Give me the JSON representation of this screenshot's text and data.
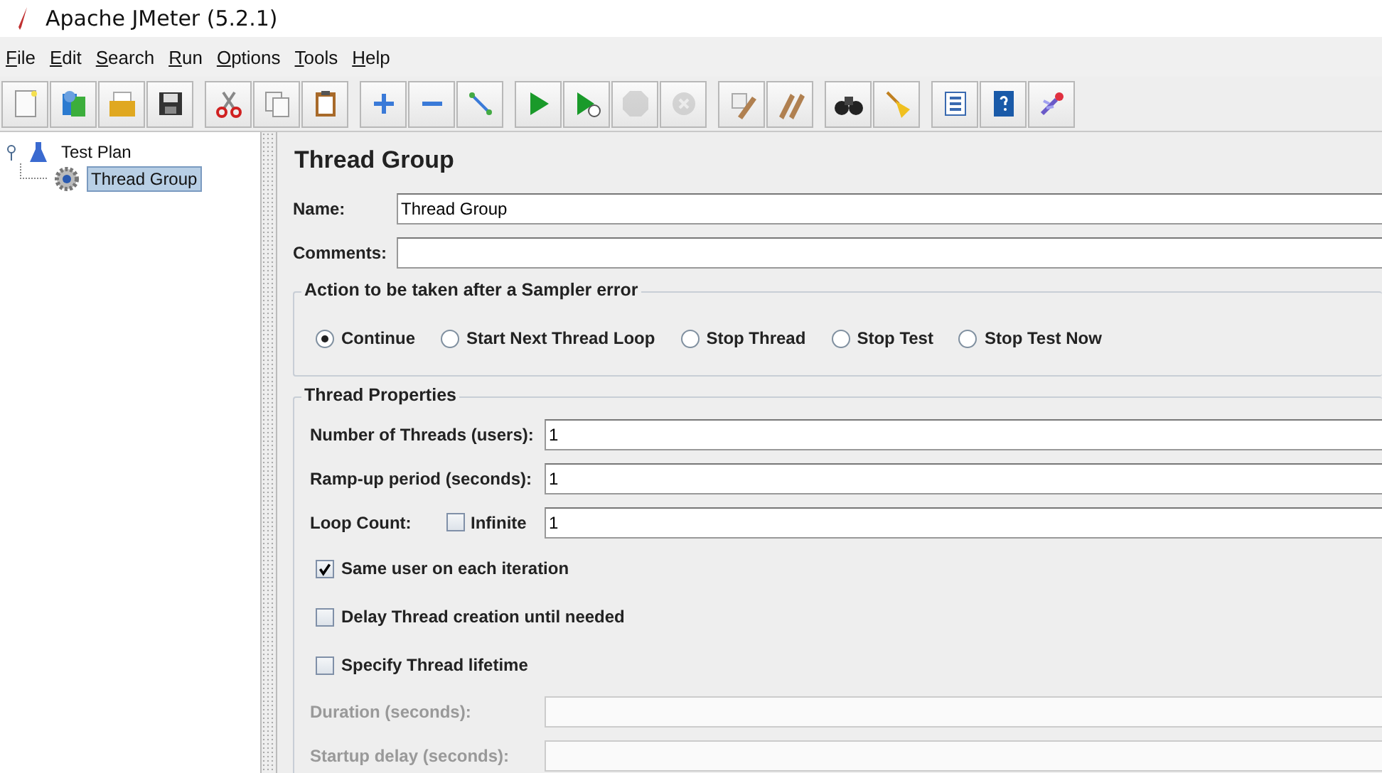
{
  "window": {
    "title": "Apache JMeter (5.2.1)"
  },
  "menu": [
    "File",
    "Edit",
    "Search",
    "Run",
    "Options",
    "Tools",
    "Help"
  ],
  "toolbar": [
    [
      {
        "disabled": false
      },
      {
        "disabled": false
      },
      {
        "disabled": false
      },
      {
        "disabled": false
      }
    ],
    [
      {
        "disabled": false
      },
      {
        "disabled": false
      },
      {
        "disabled": false
      }
    ],
    [
      {
        "disabled": false
      },
      {
        "disabled": false
      },
      {
        "disabled": false
      }
    ],
    [
      {
        "disabled": false
      },
      {
        "disabled": false
      },
      {
        "disabled": true
      },
      {
        "disabled": true
      }
    ],
    [
      {
        "disabled": false
      },
      {
        "disabled": false
      }
    ],
    [
      {
        "disabled": false
      },
      {
        "disabled": false
      }
    ],
    [
      {
        "disabled": false
      },
      {
        "disabled": false
      },
      {
        "disabled": false
      }
    ]
  ],
  "tree": [
    {
      "label": "Test Plan",
      "selected": false,
      "expanded": true,
      "children": [
        {
          "label": "Thread Group",
          "selected": true
        }
      ]
    }
  ],
  "panel": {
    "title": "Thread Group",
    "name_label": "Name:",
    "name_value": "Thread Group",
    "comments_label": "Comments:",
    "error_action": {
      "title": "Action to be taken after a Sampler error",
      "options": [
        {
          "label": "Continue",
          "selected": true
        },
        {
          "label": "Start Next Thread Loop",
          "selected": false
        },
        {
          "label": "Stop Thread",
          "selected": false
        },
        {
          "label": "Stop Test",
          "selected": false
        },
        {
          "label": "Stop Test Now",
          "selected": false
        }
      ]
    },
    "properties": {
      "title": "Thread Properties",
      "rows": [
        {
          "kind": "field",
          "label": "Number of Threads (users):",
          "value": "1",
          "disabled": false
        },
        {
          "kind": "field",
          "label": "Ramp-up period (seconds):",
          "value": "1",
          "disabled": false
        },
        {
          "kind": "loop",
          "label": "Loop Count:",
          "check_label": "Infinite",
          "checked": false,
          "value": "1"
        },
        {
          "kind": "check",
          "label": "Same user on each iteration",
          "checked": true
        },
        {
          "kind": "check",
          "label": "Delay Thread creation until needed",
          "checked": false
        },
        {
          "kind": "check",
          "label": "Specify Thread lifetime",
          "checked": false
        },
        {
          "kind": "field",
          "label": "Duration (seconds):",
          "disabled": true
        },
        {
          "kind": "field",
          "label": "Startup delay (seconds):",
          "disabled": true
        }
      ]
    }
  }
}
